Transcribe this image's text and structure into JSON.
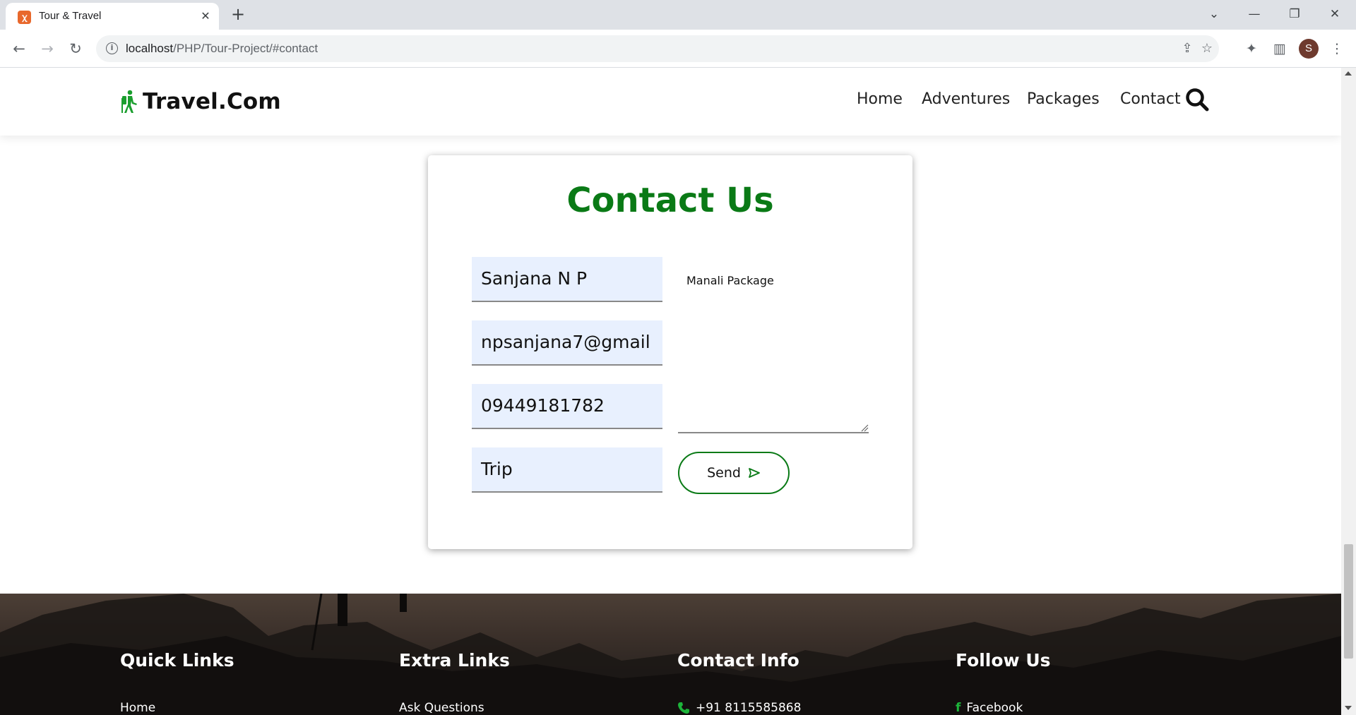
{
  "browser": {
    "tab_title": "Tour & Travel",
    "url_host": "localhost",
    "url_path": "/PHP/Tour-Project/#contact",
    "profile_initial": "S"
  },
  "header": {
    "logo_text": "Travel.Com",
    "nav": [
      "Home",
      "Adventures",
      "Packages",
      "Contact"
    ]
  },
  "contact": {
    "title": "Contact Us",
    "name_value": "Sanjana N P",
    "email_value": "npsanjana7@gmail",
    "phone_value": "09449181782",
    "subject_value": "Trip",
    "message_value": "Manali Package",
    "send_label": "Send"
  },
  "footer": {
    "columns": [
      {
        "heading": "Quick Links",
        "first_item": "Home"
      },
      {
        "heading": "Extra Links",
        "first_item": "Ask Questions"
      },
      {
        "heading": "Contact Info",
        "first_item": "+91 8115585868"
      },
      {
        "heading": "Follow Us",
        "first_item": "Facebook"
      }
    ]
  },
  "colors": {
    "accent_green": "#0a7a16",
    "field_bg": "#e8f0fe",
    "icon_green": "#1db43a"
  }
}
